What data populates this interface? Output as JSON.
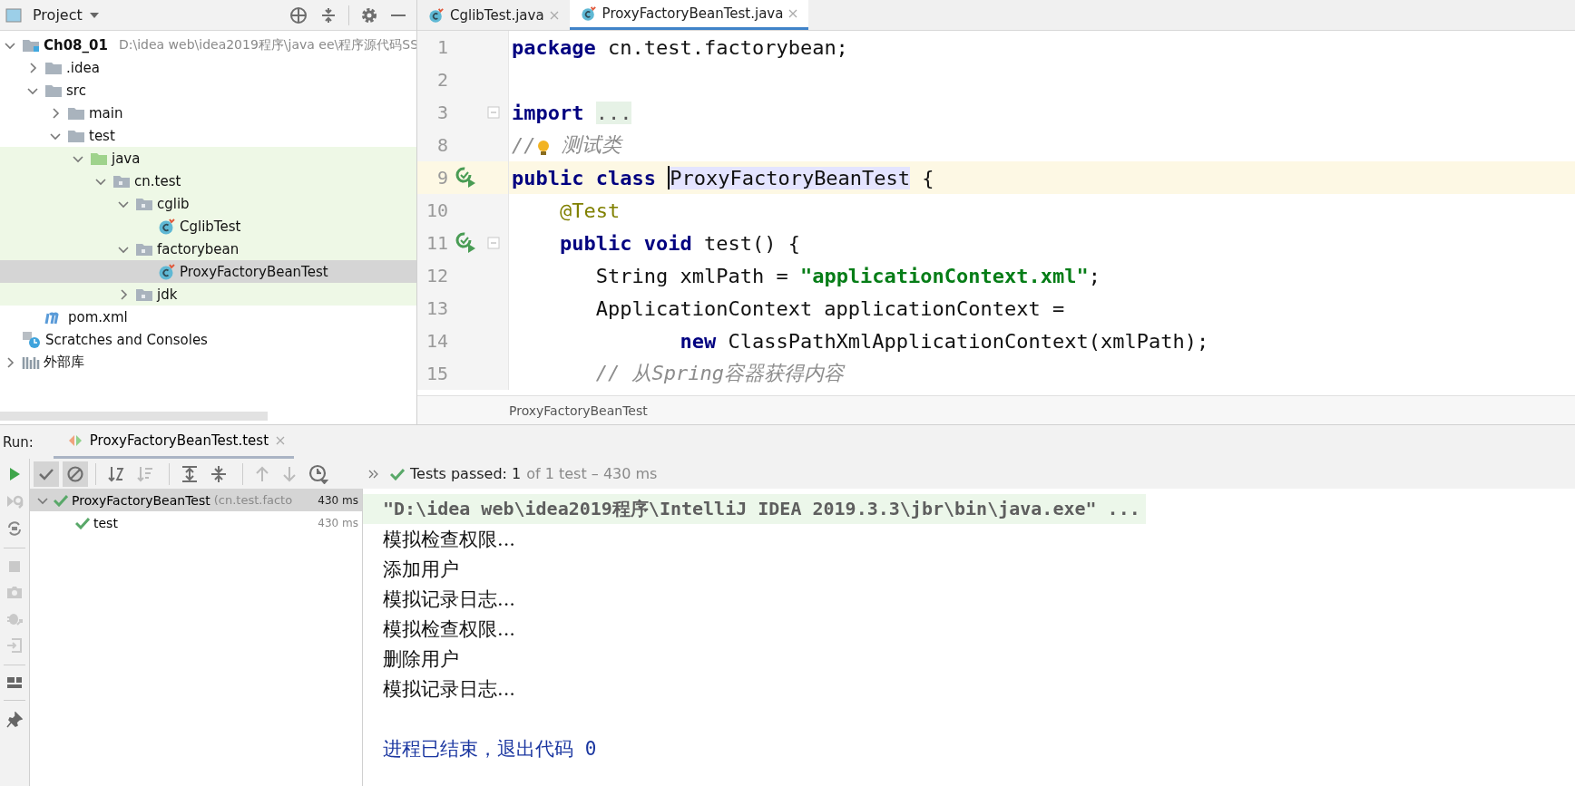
{
  "project_panel": {
    "title": "Project",
    "tree": [
      {
        "kind": "module",
        "name": "Ch08_01",
        "path": "D:\\idea web\\idea2019程序\\java ee\\程序源代码SS",
        "expanded": true,
        "selected": false,
        "children": [
          {
            "kind": "folder",
            "name": ".idea",
            "expanded": false,
            "selected": false
          },
          {
            "kind": "folder",
            "name": "src",
            "expanded": true,
            "selected": false,
            "children": [
              {
                "kind": "folder",
                "name": "main",
                "expanded": false,
                "selected": false
              },
              {
                "kind": "folder",
                "name": "test",
                "expanded": true,
                "selected": false,
                "children": [
                  {
                    "kind": "test-root",
                    "name": "java",
                    "expanded": true,
                    "selected": false,
                    "children": [
                      {
                        "kind": "package",
                        "name": "cn.test",
                        "expanded": true,
                        "selected": false,
                        "children": [
                          {
                            "kind": "package",
                            "name": "cglib",
                            "expanded": true,
                            "selected": false,
                            "children": [
                              {
                                "kind": "class",
                                "name": "CglibTest",
                                "selected": false
                              }
                            ]
                          },
                          {
                            "kind": "package",
                            "name": "factorybean",
                            "expanded": true,
                            "selected": false,
                            "children": [
                              {
                                "kind": "class",
                                "name": "ProxyFactoryBeanTest",
                                "selected": true
                              }
                            ]
                          },
                          {
                            "kind": "package",
                            "name": "jdk",
                            "expanded": false,
                            "selected": false
                          }
                        ]
                      }
                    ]
                  }
                ]
              }
            ]
          },
          {
            "kind": "maven",
            "name": "pom.xml",
            "selected": false
          }
        ]
      },
      {
        "kind": "scratches",
        "name": "Scratches and Consoles",
        "selected": false
      },
      {
        "kind": "libraries",
        "name": "外部库",
        "expanded": false,
        "selected": false
      }
    ]
  },
  "editor": {
    "tabs": [
      {
        "label": "CglibTest.java",
        "selected": false
      },
      {
        "label": "ProxyFactoryBeanTest.java",
        "selected": true
      }
    ],
    "lines": [
      {
        "number": "1",
        "current": false,
        "run_marker": false,
        "fold_marker": false,
        "tokens": [
          {
            "kind": "keyword",
            "text": "package"
          },
          {
            "kind": "plain",
            "text": " cn.test.factorybean;"
          }
        ]
      },
      {
        "number": "2",
        "current": false,
        "run_marker": false,
        "fold_marker": false
      },
      {
        "number": "3",
        "current": false,
        "run_marker": false,
        "fold_marker": true,
        "tokens": [
          {
            "kind": "keyword",
            "text": "import "
          },
          {
            "kind": "folded",
            "text": "..."
          }
        ]
      },
      {
        "number": "8",
        "current": false,
        "run_marker": false,
        "fold_marker": false,
        "tokens": [
          {
            "kind": "comment",
            "text": "//"
          },
          {
            "kind": "bulb"
          },
          {
            "kind": "comment",
            "text": " 测试类"
          }
        ]
      },
      {
        "number": "9",
        "current": true,
        "run_marker": true,
        "fold_marker": false,
        "tokens": [
          {
            "kind": "keyword",
            "text": "public class "
          },
          {
            "kind": "caret"
          },
          {
            "kind": "usage",
            "text": "ProxyFactoryBeanTest"
          },
          {
            "kind": "plain",
            "text": " {"
          }
        ]
      },
      {
        "number": "10",
        "current": false,
        "run_marker": false,
        "fold_marker": false,
        "tokens": [
          {
            "kind": "annotation",
            "text": "    @Test"
          }
        ]
      },
      {
        "number": "11",
        "current": false,
        "run_marker": true,
        "fold_marker": true,
        "tokens": [
          {
            "kind": "keyword",
            "text": "    public void"
          },
          {
            "kind": "plain",
            "text": " test() {"
          }
        ]
      },
      {
        "number": "12",
        "current": false,
        "run_marker": false,
        "fold_marker": false,
        "tokens": [
          {
            "kind": "plain",
            "text": "       String xmlPath = "
          },
          {
            "kind": "string",
            "text": "\"applicationContext.xml\""
          },
          {
            "kind": "plain",
            "text": ";"
          }
        ]
      },
      {
        "number": "13",
        "current": false,
        "run_marker": false,
        "fold_marker": false,
        "tokens": [
          {
            "kind": "plain",
            "text": "       ApplicationContext applicationContext ="
          }
        ]
      },
      {
        "number": "14",
        "current": false,
        "run_marker": false,
        "fold_marker": false,
        "tokens": [
          {
            "kind": "keyword",
            "text": "              new"
          },
          {
            "kind": "plain",
            "text": " ClassPathXmlApplicationContext(xmlPath);"
          }
        ]
      },
      {
        "number": "15",
        "current": false,
        "run_marker": false,
        "fold_marker": false,
        "tokens": [
          {
            "kind": "comment",
            "text": "       // 从Spring容器获得内容"
          }
        ]
      }
    ],
    "breadcrumb": "ProxyFactoryBeanTest"
  },
  "run": {
    "label": "Run:",
    "tab": "ProxyFactoryBeanTest.test",
    "filters": [
      {
        "kind": "passed",
        "on": true
      },
      {
        "kind": "ignored",
        "on": true
      }
    ],
    "status_main": "Tests passed: 1",
    "status_rest": "of 1 test – 430 ms",
    "tests": [
      {
        "name": "ProxyFactoryBeanTest",
        "detail": "(cn.test.facto",
        "time": "430 ms",
        "passed": true,
        "selected": true,
        "expanded": true,
        "children": [
          {
            "name": "test",
            "time": "430 ms",
            "passed": true,
            "selected": false
          }
        ]
      }
    ],
    "console": [
      {
        "kind": "command",
        "text": "\"D:\\idea web\\idea2019程序\\IntelliJ IDEA 2019.3.3\\jbr\\bin\\java.exe\" ..."
      },
      {
        "kind": "stdout",
        "text": "模拟检查权限..."
      },
      {
        "kind": "stdout",
        "text": "添加用户"
      },
      {
        "kind": "stdout",
        "text": "模拟记录日志..."
      },
      {
        "kind": "stdout",
        "text": "模拟检查权限..."
      },
      {
        "kind": "stdout",
        "text": "删除用户"
      },
      {
        "kind": "stdout",
        "text": "模拟记录日志..."
      },
      {
        "kind": "system",
        "text": "进程已结束，退出代码 0"
      }
    ]
  }
}
